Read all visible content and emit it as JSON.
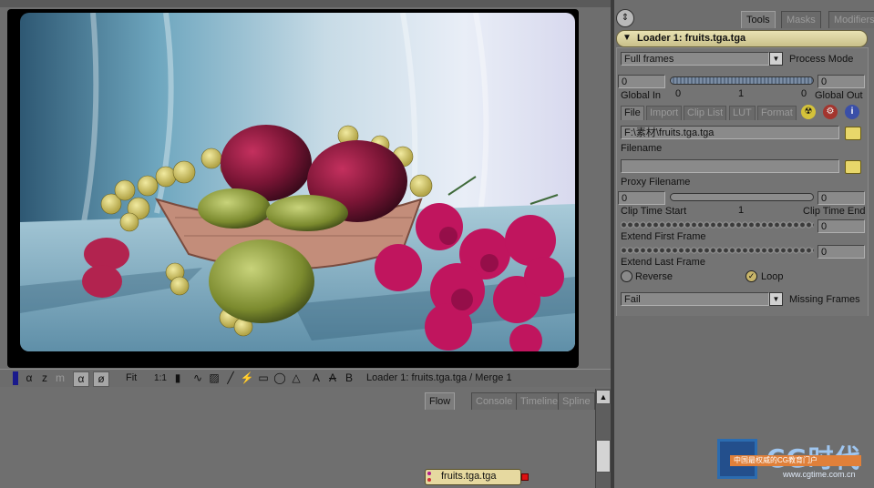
{
  "viewer": {
    "status_text": "Loader 1: fruits.tga.tga / Merge 1",
    "fit_label": "Fit",
    "zoom_label": "1:1",
    "toolbar_glyphs": [
      "α",
      "z",
      "m",
      "α",
      "ø",
      "A",
      "A",
      "B"
    ]
  },
  "flow": {
    "tabs": [
      {
        "label": "Flow",
        "active": true
      },
      {
        "label": "Console",
        "active": false
      },
      {
        "label": "Timeline",
        "active": false
      },
      {
        "label": "Spline",
        "active": false
      }
    ],
    "node_label": "fruits.tga.tga"
  },
  "right_panel": {
    "tabs": [
      {
        "label": "Tools",
        "active": true
      },
      {
        "label": "Masks",
        "active": false
      },
      {
        "label": "Modifiers",
        "active": false
      }
    ],
    "tool_header": "Loader 1: fruits.tga.tga",
    "process_mode": {
      "value": "Full frames",
      "label": "Process Mode"
    },
    "global_in": {
      "value": "0",
      "label": "Global In"
    },
    "global_out": {
      "value": "0",
      "label": "Global Out"
    },
    "global_range_ticks": [
      "0",
      "1",
      "0"
    ],
    "subtabs": [
      {
        "label": "File",
        "active": true
      },
      {
        "label": "Import",
        "active": false
      },
      {
        "label": "Clip List",
        "active": false
      },
      {
        "label": "LUT",
        "active": false
      },
      {
        "label": "Format",
        "active": false
      }
    ],
    "filename": {
      "value": "F:\\素材\\fruits.tga.tga",
      "label": "Filename"
    },
    "proxy_filename": {
      "value": "",
      "label": "Proxy Filename"
    },
    "clip_time_start": {
      "value": "0",
      "label": "Clip Time Start"
    },
    "clip_time_end": {
      "value": "0",
      "label": "Clip Time End"
    },
    "clip_mid_tick": "1",
    "extend_first": {
      "value": "0",
      "label": "Extend First Frame"
    },
    "extend_last": {
      "value": "0",
      "label": "Extend Last Frame"
    },
    "reverse_label": "Reverse",
    "loop_label": "Loop",
    "missing_frames": {
      "value": "Fail",
      "label": "Missing Frames"
    }
  },
  "watermark": {
    "title": "CG时代",
    "subtitle": "中国最权威的CG教育门户",
    "url": "www.cgtime.com.cn"
  },
  "colors": {
    "panel_bg": "#6e6e6e",
    "header_gold": "#d8cf9a",
    "node_color": "#e6d9a0"
  }
}
